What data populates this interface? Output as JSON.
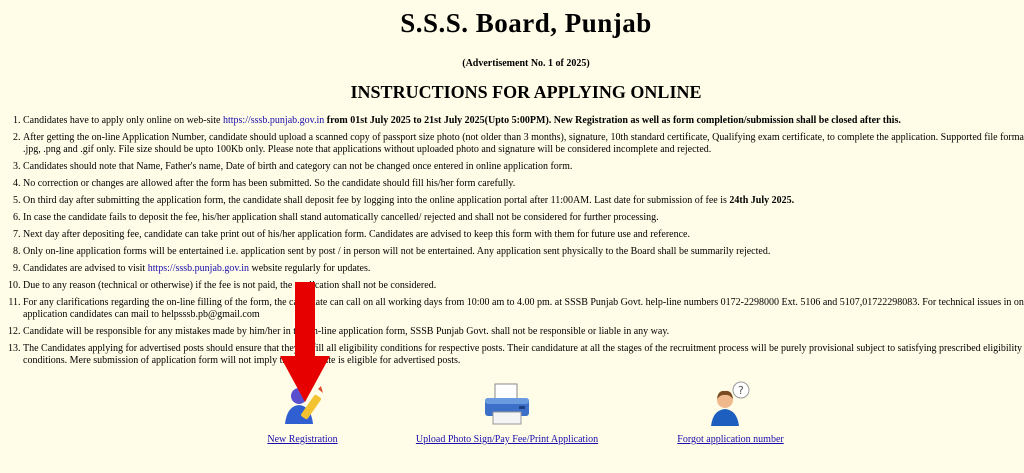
{
  "title": "S.S.S. Board, Punjab",
  "advertisement": "(Advertisement No. 1 of 2025)",
  "heading": "INSTRUCTIONS FOR APPLYING ONLINE",
  "instructions": [
    {
      "pre": "Candidates have to apply only online on web-site ",
      "link": "https://sssb.punjab.gov.in",
      "bold": " from 01st July 2025 to 21st July 2025(Upto 5:00PM). New Registration as well as form completion/submission shall be closed after this."
    },
    {
      "text": "After getting the on-line Application Number, candidate should upload a scanned copy of passport size photo (not older than 3 months), signature, 10th standard certificate, Qualifying exam certificate, to complete the application. Supported file formats are .jpg, .png and .gif only. File size should be upto 100Kb only. Please note that applications without uploaded photo and signature will be considered incomplete and rejected."
    },
    {
      "text": "Candidates should note that Name, Father's name, Date of birth and category can not be changed once entered in online application form."
    },
    {
      "text": "No correction or changes are allowed after the form has been submitted. So the candidate should fill his/her form carefully."
    },
    {
      "pre": "On third day after submitting the application form, the candidate shall deposit fee by logging into the online application portal after 11:00AM. Last date for submission of fee is ",
      "bold": "24th July 2025."
    },
    {
      "text": "In case the candidate fails to deposit the fee, his/her application shall stand automatically cancelled/ rejected and shall not be considered for further processing."
    },
    {
      "text": "Next day after depositing fee, candidate can take print out of his/her application form. Candidates are advised to keep this form with them for future use and reference."
    },
    {
      "text": "Only on-line application forms will be entertained i.e. application sent by post / in person will not be entertained. Any application sent physically to the Board shall be summarily rejected."
    },
    {
      "pre": "Candidates are advised to visit ",
      "link": "https://sssb.punjab.gov.in",
      "post": " website regularly for updates."
    },
    {
      "text": "Due to any reason (technical or otherwise) if the fee is not paid, the application shall not be considered."
    },
    {
      "text": "For any clarifications regarding the on-line filling of the form, the candidate can call on all working days from 10:00 am to 4.00 pm. at SSSB Punjab Govt. help-line numbers 0172-2298000 Ext. 5106 and 5107,01722298083. For technical issues in online application candidates can mail to helpsssb.pb@gmail.com"
    },
    {
      "text": "Candidate will be responsible for any mistakes made by him/her in the on-line application form, SSSB Punjab Govt. shall not be responsible or liable in any way."
    },
    {
      "text": "The Candidates applying for advertised posts should ensure that they fulfill all eligibility conditions for respective posts. Their candidature at all the stages of the recruitment process will be purely provisional subject to satisfying prescribed eligibility conditions. Mere submission of application form will not imply that candidate is eligible for advertised posts."
    }
  ],
  "actions": {
    "new_registration": {
      "label": "New Registration",
      "icon": "edit-user-icon"
    },
    "upload": {
      "label": "Upload Photo Sign/Pay Fee/Print Application",
      "icon": "printer-icon"
    },
    "forgot": {
      "label": "Forgot application number",
      "icon": "question-user-icon"
    }
  },
  "colors": {
    "background": "#fffde7",
    "link": "#1a0dab",
    "arrow": "#e60000"
  }
}
